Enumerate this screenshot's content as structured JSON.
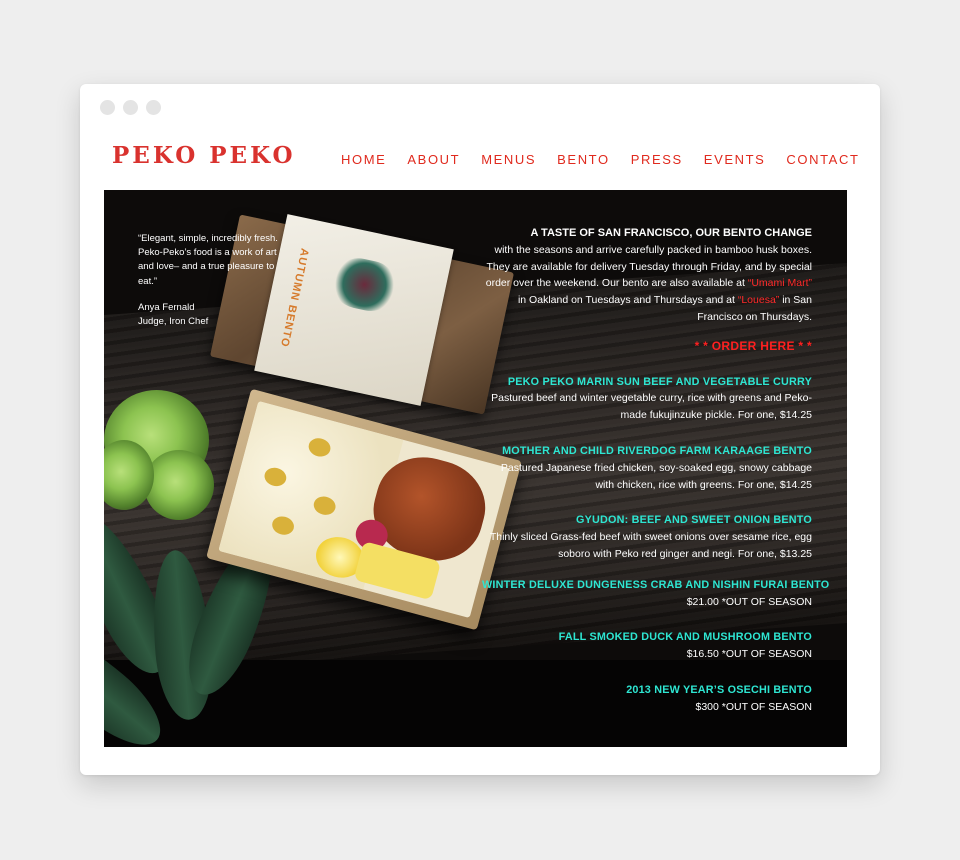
{
  "window": {
    "controls": [
      "close",
      "minimize",
      "maximize"
    ]
  },
  "header": {
    "logo": "PEKO PEKO",
    "nav": [
      "HOME",
      "ABOUT",
      "MENUS",
      "BENTO",
      "PRESS",
      "EVENTS",
      "CONTACT"
    ]
  },
  "hero": {
    "box_label": "AUTUMN BENTO",
    "quote": {
      "text": "“Elegant, simple, incredibly fresh. Peko-Peko’s food is a work of art and love– and a true pleasure to eat.”",
      "author": "Anya Fernald",
      "role": "Judge, Iron Chef"
    },
    "intro": {
      "lead": "A TASTE OF SAN FRANCISCO, OUR BENTO CHANGE",
      "part1": "with the seasons and arrive carefully packed in bamboo husk boxes. They are available for delivery Tuesday through Friday, and by special order over the weekend. Our bento are also available at ",
      "link1": "“Umami Mart”",
      "part2": " in Oakland on Tuesdays and Thursdays and at ",
      "link2": "“Louesa”",
      "part3": " in San Francisco on Thursdays."
    },
    "order_label": "* * ORDER HERE * *",
    "menu_items": [
      {
        "name": "PEKO PEKO MARIN SUN BEEF AND VEGETABLE CURRY",
        "desc": "Pastured beef and winter vegetable curry, rice with greens and Peko-made fukujinzuke pickle. For one, $14.25"
      },
      {
        "name": "MOTHER AND CHILD RIVERDOG FARM KARAAGE BENTO",
        "desc": "Pastured Japanese fried chicken, soy-soaked egg, snowy cabbage with chicken, rice with greens. For one, $14.25"
      },
      {
        "name": "GYUDON: BEEF AND SWEET ONION BENTO",
        "desc": "Thinly sliced Grass-fed beef with sweet onions over sesame rice, egg soboro with Peko red ginger and negi. For one, $13.25"
      },
      {
        "name": "WINTER DELUXE DUNGENESS CRAB AND NISHIN FURAI BENTO",
        "desc": "$21.00 *OUT OF SEASON"
      },
      {
        "name": "FALL SMOKED DUCK AND MUSHROOM BENTO",
        "desc": "$16.50 *OUT OF SEASON"
      },
      {
        "name": "2013 NEW YEAR’S OSECHI BENTO",
        "desc": "$300 *OUT OF SEASON"
      }
    ]
  },
  "colors": {
    "accent": "#e02a1e",
    "menu_name": "#2ee6d2",
    "hero_bg": "#0d0b0a"
  }
}
